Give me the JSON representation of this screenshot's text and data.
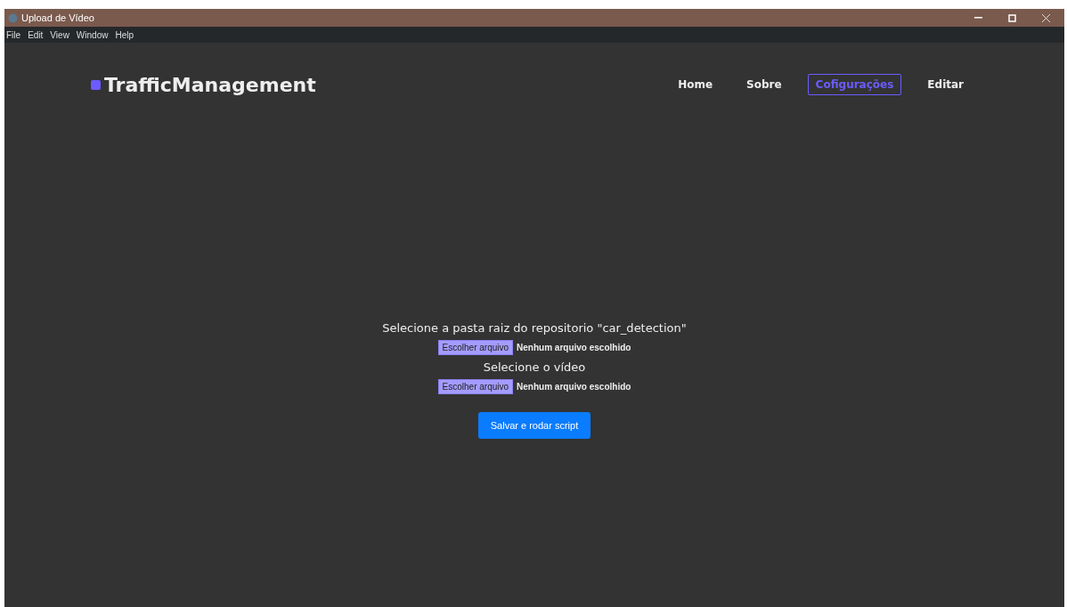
{
  "window": {
    "title": "Upload de Vídeo"
  },
  "menu": [
    "File",
    "Edit",
    "View",
    "Window",
    "Help"
  ],
  "brand": "TrafficManagement",
  "nav": [
    {
      "label": "Home",
      "selected": false
    },
    {
      "label": "Sobre",
      "selected": false
    },
    {
      "label": "Cofigurações",
      "selected": true
    },
    {
      "label": "Editar",
      "selected": false
    }
  ],
  "form": [
    {
      "kind": "heading",
      "text": "Selecione a pasta raiz do repositorio \"car_detection\""
    },
    {
      "kind": "file",
      "button": "Escolher arquivo",
      "status": "Nenhum arquivo escolhido"
    },
    {
      "kind": "heading",
      "text": "Selecione o vídeo"
    },
    {
      "kind": "file",
      "button": "Escolher arquivo",
      "status": "Nenhum arquivo escolhido"
    }
  ],
  "submit": "Salvar e rodar script"
}
